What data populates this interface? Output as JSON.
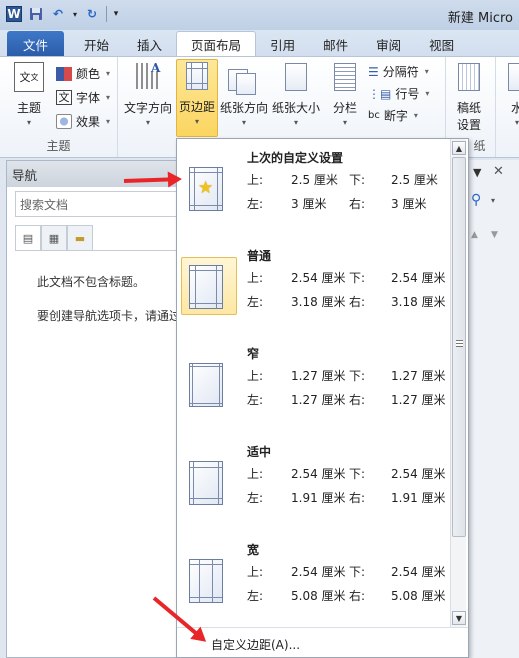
{
  "window": {
    "title": "新建 Micro"
  },
  "quick_access": [
    {
      "icon": "word-icon",
      "label": "W"
    },
    {
      "icon": "save-icon"
    },
    {
      "icon": "undo-icon"
    },
    {
      "icon": "redo-icon"
    },
    {
      "icon": "customize-qat-icon"
    }
  ],
  "tabs": [
    {
      "label": "文件",
      "state": "file"
    },
    {
      "label": "开始"
    },
    {
      "label": "插入"
    },
    {
      "label": "页面布局",
      "state": "active"
    },
    {
      "label": "引用"
    },
    {
      "label": "邮件"
    },
    {
      "label": "审阅"
    },
    {
      "label": "视图"
    }
  ],
  "ribbon": {
    "theme_group": {
      "label": "主题",
      "theme_button": "主题",
      "colors": "颜色",
      "fonts": "字体",
      "effects": "效果"
    },
    "page_setup": {
      "text_direction": "文字方向",
      "margins": "页边距",
      "orientation": "纸张方向",
      "size": "纸张大小",
      "columns": "分栏",
      "breaks": "分隔符",
      "line_numbers": "行号",
      "hyphenation": "断字",
      "hyphenation_icon_text": "bc",
      "group_label_tail": "纸"
    },
    "draft_paper": {
      "label_line1": "稿纸",
      "label_line2": "设置"
    },
    "watermark": {
      "label": "水"
    }
  },
  "navigation": {
    "title": "导航",
    "search_placeholder": "搜索文档",
    "message1": "此文档不包含标题。",
    "message2": "要创建导航选项卡，请通过"
  },
  "margins_menu": {
    "label_top": "上:",
    "label_bottom": "下:",
    "label_left": "左:",
    "label_right": "右:",
    "presets": [
      {
        "name": "上次的自定义设置",
        "top": "2.5 厘米",
        "bottom": "2.5 厘米",
        "left": "3 厘米",
        "right": "3 厘米",
        "icon": "star-icon"
      },
      {
        "name": "普通",
        "top": "2.54 厘米",
        "bottom": "2.54 厘米",
        "left": "3.18 厘米",
        "right": "3.18 厘米",
        "selected": true
      },
      {
        "name": "窄",
        "top": "1.27 厘米",
        "bottom": "1.27 厘米",
        "left": "1.27 厘米",
        "right": "1.27 厘米"
      },
      {
        "name": "适中",
        "top": "2.54 厘米",
        "bottom": "2.54 厘米",
        "left": "1.91 厘米",
        "right": "1.91 厘米"
      },
      {
        "name": "宽",
        "top": "2.54 厘米",
        "bottom": "2.54 厘米",
        "left": "5.08 厘米",
        "right": "5.08 厘米"
      }
    ],
    "custom_margins": "自定义边距(A)..."
  },
  "colors": {
    "accent": "#2a5ca8",
    "highlight": "#fbd560",
    "annotation_arrow": "#e8262a"
  }
}
